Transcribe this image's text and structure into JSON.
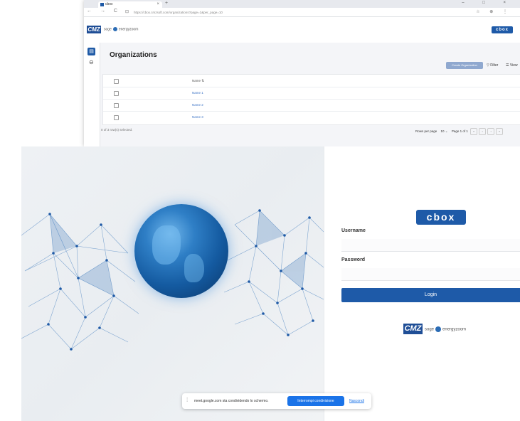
{
  "browser": {
    "tab_title": "cbox",
    "tab_close": "×",
    "new_tab": "+",
    "window_controls": "– □ ×",
    "nav_buttons": "← → C",
    "lock_icon": "lock-icon",
    "url": "https://cbox.cmzsoft.com/organizations?page=1&per_page=10",
    "addr_icons": "☆ ⊕ ⋮"
  },
  "app_header": {
    "logo_cmz": "CMZ",
    "partner_left": "soge",
    "partner_right": "energyzoom",
    "logo_cbox": "cbox"
  },
  "sidebar": {
    "item1_icon": "▤",
    "item2_icon": "⊖"
  },
  "organizations": {
    "title": "Organizations",
    "create_button": "Create Organization",
    "filter_button": "▽ Filter",
    "view_button": "☰ View",
    "column_name": "Name ⇅",
    "rows": [
      "Name 1",
      "Name 2",
      "Name 3"
    ],
    "selection_text": "0 of 3 row(s) selected.",
    "rows_per_page_label": "Rows per page",
    "rows_per_page_value": "10 ⌄",
    "page_info": "Page 1 of 1",
    "pager_buttons": [
      "«",
      "‹",
      "›",
      "»"
    ]
  },
  "login": {
    "logo_cbox": "cbox",
    "username_label": "Username",
    "username_value": "",
    "password_label": "Password",
    "password_value": "",
    "login_button": "Login",
    "footer_logo_cmz": "CMZ",
    "footer_partner_left": "soge",
    "footer_partner_right": "energyzoom"
  },
  "share_bar": {
    "grip": "⁞",
    "message": "meet.google.com sta condividendo lo schermo.",
    "stop_button": "Interrompi condivisione",
    "hide_link": "Nascondi"
  },
  "colors": {
    "brand_blue": "#1e5aa8",
    "share_blue": "#1a73e8"
  }
}
